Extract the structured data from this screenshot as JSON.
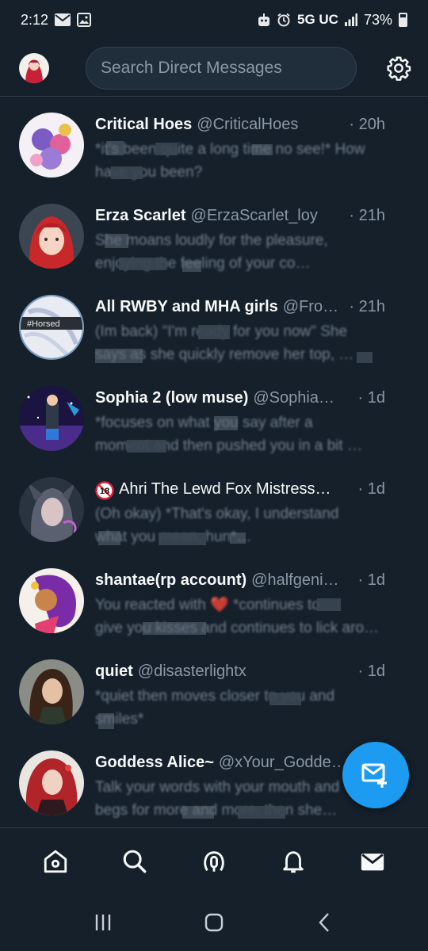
{
  "status_bar": {
    "time": "2:12",
    "network": "5G UC",
    "battery": "73%"
  },
  "header": {
    "search_placeholder": "Search Direct Messages"
  },
  "conversations": [
    {
      "name": "Critical Hoes",
      "handle": "@CriticalHoes",
      "time": "· 20h",
      "line1": "*it's been quite a long time no see!* How",
      "line2": "have you been?"
    },
    {
      "name": "Erza Scarlet",
      "handle": "@ErzaScarlet_loy",
      "time": "· 21h",
      "line1": "She moans loudly for the pleasure,",
      "line2": "enjoying the feeling of your co…"
    },
    {
      "name": "All RWBY and MHA girls",
      "handle": "@Fro…",
      "time": "· 21h",
      "line1": "(Im back) \"I'm ready for you now\" She",
      "line2": "says as she quickly remove her top, …"
    },
    {
      "name": "Sophia 2 (low muse)",
      "handle": "@Sophia…",
      "time": "· 1d",
      "line1": "*focuses on what you say after a",
      "line2": "moment and then pushed you in a bit …"
    },
    {
      "name": "Ahri The Lewd Fox Mistress…",
      "handle": "",
      "time": "· 1d",
      "badge": "18",
      "line1": "(Oh okay) *That's okay, I understand",
      "line2": "what you mean, hun*…"
    },
    {
      "name": "shantae(rp account)",
      "handle": "@halfgeni…",
      "time": "· 1d",
      "line1": "You reacted with ❤️ *continues to",
      "line2": "give you kisses and continues to lick aroun…"
    },
    {
      "name": "quiet",
      "handle": "@disasterlightx",
      "time": "· 1d",
      "line1": "*quiet then moves closer to you and",
      "line2": "smiles*"
    },
    {
      "name": "Goddess Alice~",
      "handle": "@xYour_Godde…",
      "time": "",
      "line1": "Talk your words with your mouth and",
      "line2": "begs for more and more, then she…"
    }
  ],
  "colors": {
    "background": "#15202b",
    "accent": "#1d9bf0",
    "secondary_text": "#8b98a5",
    "primary_text": "#f7f9f9"
  }
}
